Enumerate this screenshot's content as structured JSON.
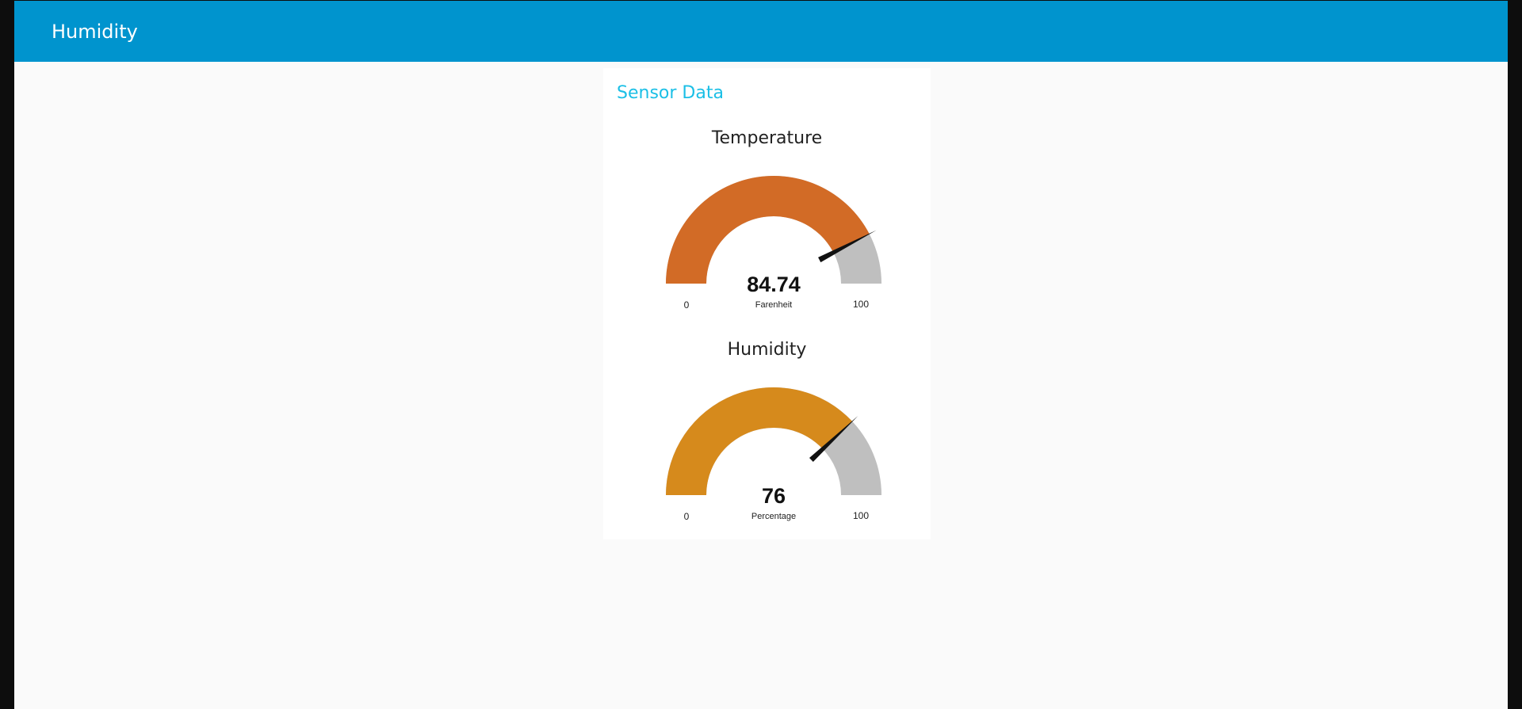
{
  "header": {
    "title": "Humidity",
    "color": "#0094ce"
  },
  "card": {
    "title": "Sensor Data",
    "title_color": "#1bbfe6"
  },
  "gauges": [
    {
      "title": "Temperature",
      "value": 84.74,
      "value_text": "84.74",
      "unit": "Farenheit",
      "min": 0,
      "max": 100,
      "min_label": "0",
      "max_label": "100",
      "fill_color": "#d26b26",
      "track_color": "#bfbfbf",
      "needle_color": "#111111"
    },
    {
      "title": "Humidity",
      "value": 76,
      "value_text": "76",
      "unit": "Percentage",
      "min": 0,
      "max": 100,
      "min_label": "0",
      "max_label": "100",
      "fill_color": "#d68a1c",
      "track_color": "#bfbfbf",
      "needle_color": "#111111"
    }
  ]
}
